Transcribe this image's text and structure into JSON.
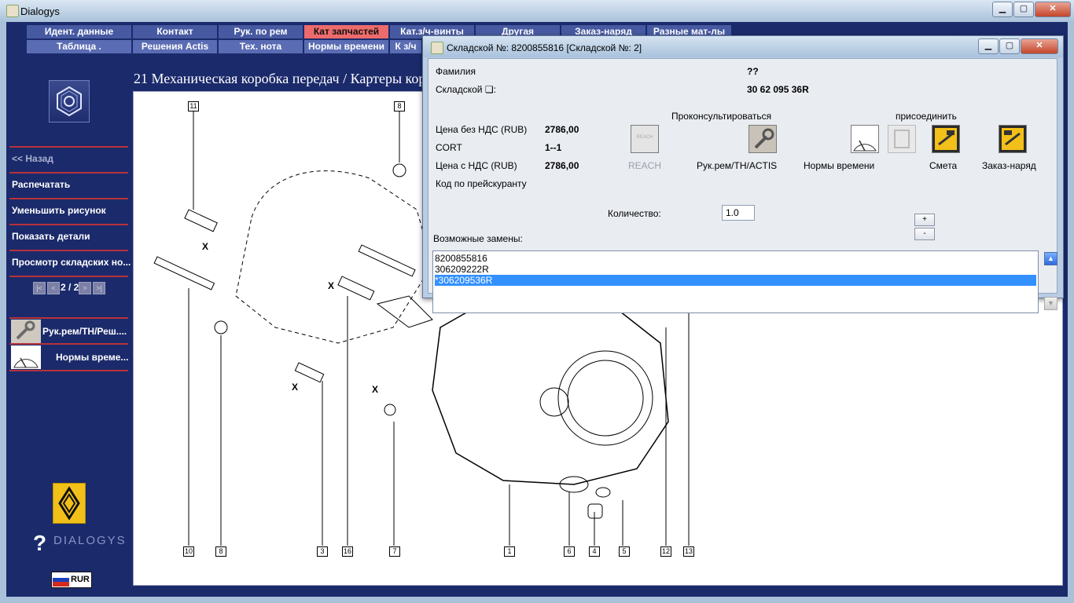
{
  "window": {
    "title": "Dialogys"
  },
  "menu": {
    "row1": [
      "Идент. данные",
      "Контакт",
      "Рук. по рем",
      "Кат запчастей",
      "Кат.з/ч-винты",
      "Другая",
      "Заказ-наряд",
      "Разные мат-лы"
    ],
    "row2": [
      "Таблица .",
      "Решения Actis",
      "Тех. нота",
      "Нормы времени",
      "К з/ч"
    ],
    "active_tab": "Кат запчастей"
  },
  "left_panel": {
    "back": "<< Назад",
    "print": "Распечатать",
    "reduce": "Уменьшить рисунок",
    "show_details": "Показать детали",
    "view_stock": "Просмотр складских но...",
    "page_indicator": "2 / 2",
    "shortcut_repair": "Рук.рем/ТН/Реш....",
    "shortcut_times": "Нормы време...",
    "logo_text": "DIALOGYS",
    "currency": "RUR"
  },
  "drawing": {
    "title": "21 Механическая коробка передач / Картеры коробки передач",
    "callouts": [
      "11",
      "8",
      "10",
      "8",
      "3",
      "16",
      "7",
      "1",
      "6",
      "4",
      "5",
      "12",
      "13"
    ],
    "x_marks": [
      "X",
      "X",
      "X",
      "X"
    ]
  },
  "dialog": {
    "title": "Складской №: 8200855816 [Складской №: 2]",
    "surname_label": "Фамилия",
    "surname_value": "??",
    "stock_label": "Складской ❏:",
    "stock_value": "30 62 095 36R",
    "consult_header": "Проконсультироваться",
    "attach_header": "присоединить",
    "price_excl_label": "Цена без НДС (RUB)",
    "price_excl_value": "2786,00",
    "cort_label": "CORT",
    "cort_value": "1--1",
    "price_incl_label": "Цена с НДС (RUB)",
    "price_incl_value": "2786,00",
    "pricelist_code_label": "Код по прейскуранту",
    "quantity_label": "Количество:",
    "quantity_value": "1.0",
    "reach_label": "REACH",
    "reach_icon_text": "REACH",
    "repair_label": "Рук.рем/ТН/ACTIS",
    "times_label": "Нормы времени",
    "estimate_label": "Смета",
    "workorder_label": "Заказ-наряд",
    "plus": "+",
    "minus": "-",
    "substitutes_label": "Возможные замены:",
    "substitutes": [
      "8200855816",
      "306209222R",
      "*306209536R"
    ],
    "selected_substitute_index": 2
  }
}
